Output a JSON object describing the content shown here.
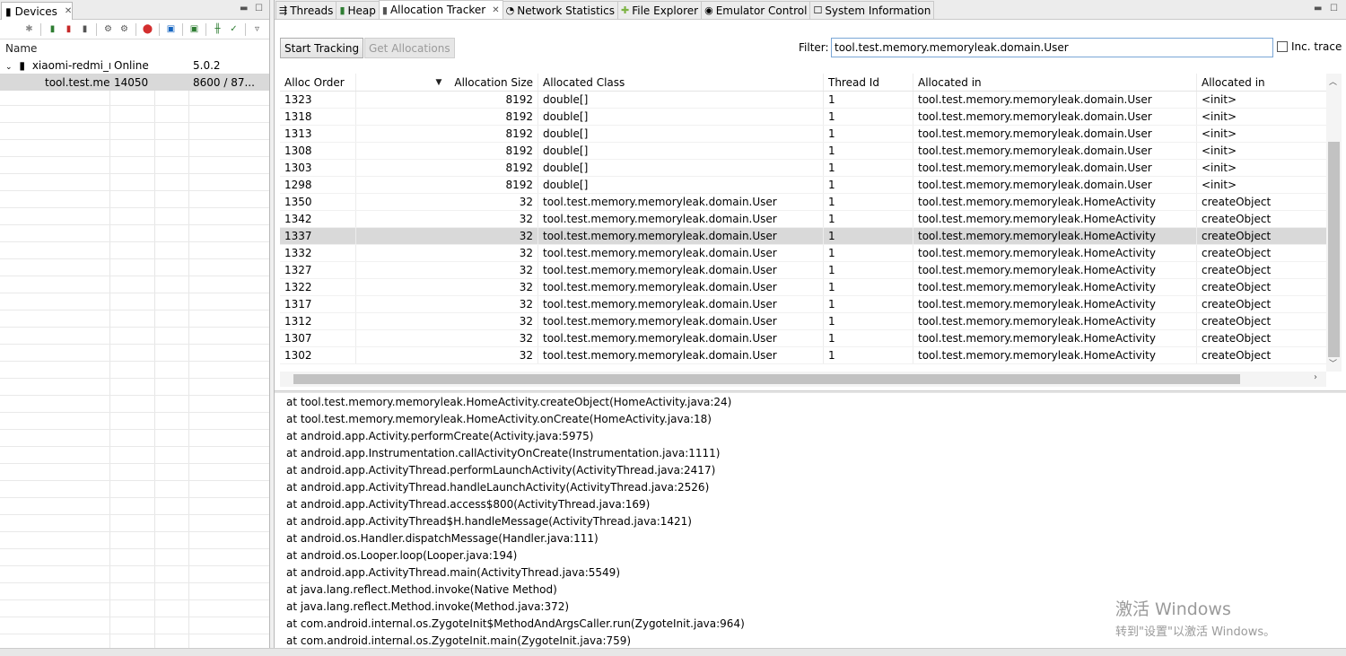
{
  "devices_panel": {
    "tab_label": "Devices",
    "columns": [
      "Name",
      "",
      "",
      ""
    ],
    "device": {
      "name": "xiaomi-redmi_r",
      "status": "Online",
      "version": "5.0.2"
    },
    "process": {
      "name": "tool.test.me",
      "pid": "14050",
      "port": "8600 / 87..."
    }
  },
  "main_tabs": [
    {
      "label": "Threads",
      "icon": "threads-icon",
      "active": false
    },
    {
      "label": "Heap",
      "icon": "heap-icon",
      "active": false
    },
    {
      "label": "Allocation Tracker",
      "icon": "allocation-icon",
      "active": true
    },
    {
      "label": "Network Statistics",
      "icon": "network-icon",
      "active": false
    },
    {
      "label": "File Explorer",
      "icon": "android-icon",
      "active": false
    },
    {
      "label": "Emulator Control",
      "icon": "emulator-icon",
      "active": false
    },
    {
      "label": "System Information",
      "icon": "window-icon",
      "active": false
    }
  ],
  "controls": {
    "start_tracking": "Start Tracking",
    "get_allocations": "Get Allocations",
    "filter_label": "Filter:",
    "filter_value": "tool.test.memory.memoryleak.domain.User",
    "inc_trace": "Inc. trace"
  },
  "table": {
    "headers": [
      "Alloc Order",
      "Allocation Size",
      "Allocated Class",
      "Thread Id",
      "Allocated in",
      "Allocated in"
    ],
    "rows": [
      [
        "1323",
        "8192",
        "double[]",
        "1",
        "tool.test.memory.memoryleak.domain.User",
        "<init>"
      ],
      [
        "1318",
        "8192",
        "double[]",
        "1",
        "tool.test.memory.memoryleak.domain.User",
        "<init>"
      ],
      [
        "1313",
        "8192",
        "double[]",
        "1",
        "tool.test.memory.memoryleak.domain.User",
        "<init>"
      ],
      [
        "1308",
        "8192",
        "double[]",
        "1",
        "tool.test.memory.memoryleak.domain.User",
        "<init>"
      ],
      [
        "1303",
        "8192",
        "double[]",
        "1",
        "tool.test.memory.memoryleak.domain.User",
        "<init>"
      ],
      [
        "1298",
        "8192",
        "double[]",
        "1",
        "tool.test.memory.memoryleak.domain.User",
        "<init>"
      ],
      [
        "1350",
        "32",
        "tool.test.memory.memoryleak.domain.User",
        "1",
        "tool.test.memory.memoryleak.HomeActivity",
        "createObject"
      ],
      [
        "1342",
        "32",
        "tool.test.memory.memoryleak.domain.User",
        "1",
        "tool.test.memory.memoryleak.HomeActivity",
        "createObject"
      ],
      [
        "1337",
        "32",
        "tool.test.memory.memoryleak.domain.User",
        "1",
        "tool.test.memory.memoryleak.HomeActivity",
        "createObject"
      ],
      [
        "1332",
        "32",
        "tool.test.memory.memoryleak.domain.User",
        "1",
        "tool.test.memory.memoryleak.HomeActivity",
        "createObject"
      ],
      [
        "1327",
        "32",
        "tool.test.memory.memoryleak.domain.User",
        "1",
        "tool.test.memory.memoryleak.HomeActivity",
        "createObject"
      ],
      [
        "1322",
        "32",
        "tool.test.memory.memoryleak.domain.User",
        "1",
        "tool.test.memory.memoryleak.HomeActivity",
        "createObject"
      ],
      [
        "1317",
        "32",
        "tool.test.memory.memoryleak.domain.User",
        "1",
        "tool.test.memory.memoryleak.HomeActivity",
        "createObject"
      ],
      [
        "1312",
        "32",
        "tool.test.memory.memoryleak.domain.User",
        "1",
        "tool.test.memory.memoryleak.HomeActivity",
        "createObject"
      ],
      [
        "1307",
        "32",
        "tool.test.memory.memoryleak.domain.User",
        "1",
        "tool.test.memory.memoryleak.HomeActivity",
        "createObject"
      ],
      [
        "1302",
        "32",
        "tool.test.memory.memoryleak.domain.User",
        "1",
        "tool.test.memory.memoryleak.HomeActivity",
        "createObject"
      ]
    ],
    "selected_row": 8
  },
  "stack_trace": [
    "at tool.test.memory.memoryleak.HomeActivity.createObject(HomeActivity.java:24)",
    "at tool.test.memory.memoryleak.HomeActivity.onCreate(HomeActivity.java:18)",
    "at android.app.Activity.performCreate(Activity.java:5975)",
    "at android.app.Instrumentation.callActivityOnCreate(Instrumentation.java:1111)",
    "at android.app.ActivityThread.performLaunchActivity(ActivityThread.java:2417)",
    "at android.app.ActivityThread.handleLaunchActivity(ActivityThread.java:2526)",
    "at android.app.ActivityThread.access$800(ActivityThread.java:169)",
    "at android.app.ActivityThread$H.handleMessage(ActivityThread.java:1421)",
    "at android.os.Handler.dispatchMessage(Handler.java:111)",
    "at android.os.Looper.loop(Looper.java:194)",
    "at android.app.ActivityThread.main(ActivityThread.java:5549)",
    "at java.lang.reflect.Method.invoke(Native Method)",
    "at java.lang.reflect.Method.invoke(Method.java:372)",
    "at com.android.internal.os.ZygoteInit$MethodAndArgsCaller.run(ZygoteInit.java:964)",
    "at com.android.internal.os.ZygoteInit.main(ZygoteInit.java:759)"
  ],
  "watermark": {
    "line1": "激活 Windows",
    "line2": "转到\"设置\"以激活 Windows。"
  }
}
